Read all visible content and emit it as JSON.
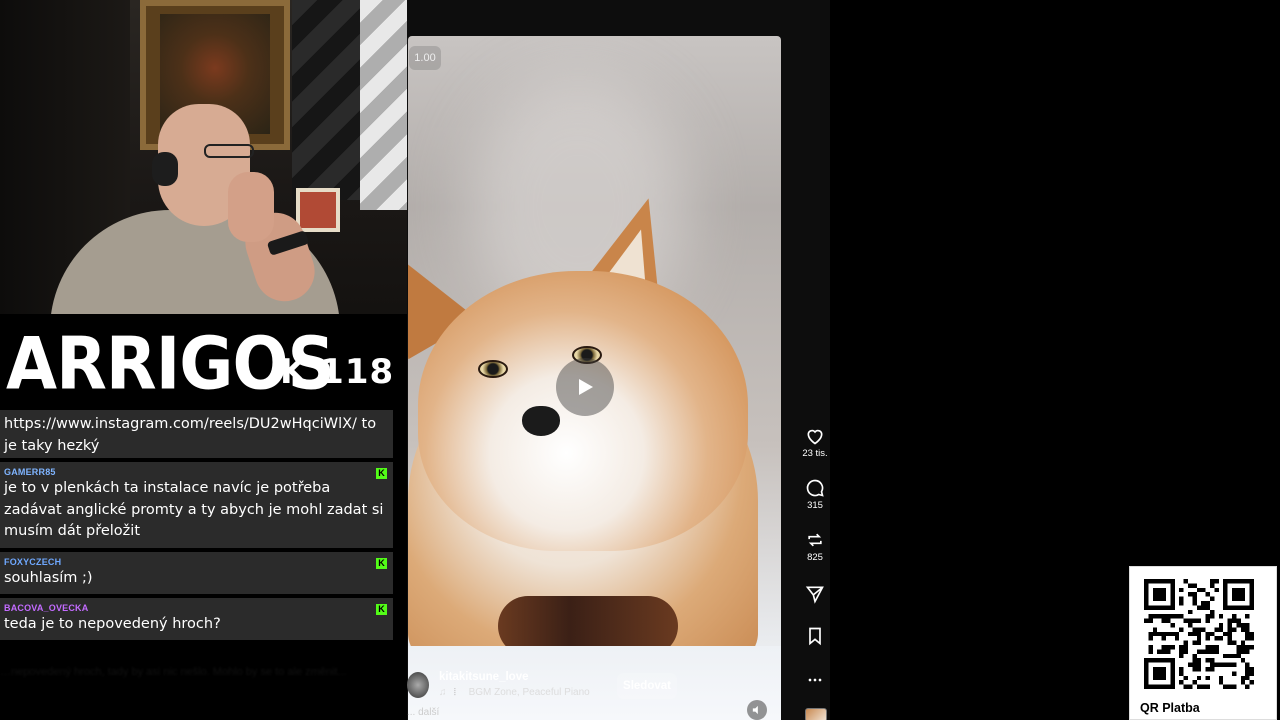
{
  "overlay": {
    "brand": "ARRIGOS",
    "tag": "K 118"
  },
  "chat": {
    "messages": [
      {
        "user": "",
        "text": "https://www.instagram.com/reels/DU2wHqciWlX/ to je taky hezký",
        "user_color": "#ffffff"
      },
      {
        "user": "GAMERR85",
        "text": "je to v plenkách ta instalace navíc je potřeba zadávat anglické promty a ty abych je mohl zadat si musím dát přeložit",
        "user_color": "#7fb4ff"
      },
      {
        "user": "FOXYCZECH",
        "text": "souhlasím ;)",
        "user_color": "#6fa8ff"
      },
      {
        "user": "BACOVA_OVECKA",
        "text": "teda je to nepovedený hroch?",
        "user_color": "#c36bff"
      }
    ],
    "platform_badge": "K",
    "faded": "…nepovedený hroch, tady by asi nic nešlo. Mohlo by se to ale změnit..."
  },
  "reel": {
    "speed": "1.00",
    "username": "kitakitsune_love",
    "music": "BGM Zone, Peaceful Piano",
    "follow": "Sledovat",
    "more": "... další",
    "actions": {
      "likes": "23 tis.",
      "comments": "315",
      "reposts": "825"
    },
    "icons": [
      "heart-icon",
      "comment-icon",
      "repost-icon",
      "send-icon",
      "bookmark-icon",
      "more-icon",
      "play-icon",
      "mute-icon",
      "music-note-icon"
    ]
  },
  "qr": {
    "label": "QR Platba"
  },
  "colors": {
    "kick_green": "#53fc18",
    "chat_bg": "#2b2b2b"
  }
}
